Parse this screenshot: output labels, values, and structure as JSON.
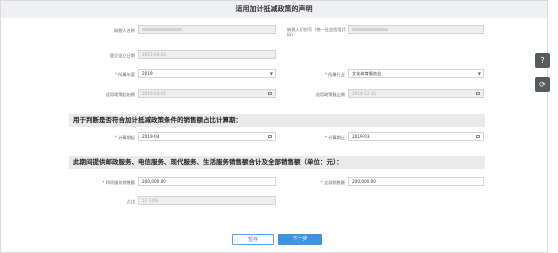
{
  "dialog": {
    "title": "适用加计抵减政策的声明"
  },
  "fields": {
    "taxpayer_name": {
      "label": "纳税人名称"
    },
    "taxpayer_id": {
      "label": "纳税人识别号（统一社会信用代码）"
    },
    "reg_date": {
      "label": "登记设立日期",
      "value": "2011-04-02"
    },
    "select_year": {
      "label": "* 所属年度",
      "value": "2019"
    },
    "industry": {
      "label": "* 所属行业",
      "value": "文化体育服务业"
    },
    "policy_start": {
      "label": "适用政策起始期",
      "value": "2019-04-01"
    },
    "policy_end": {
      "label": "适用政策截止期",
      "value": "2019-12-31"
    },
    "calc_start": {
      "label": "* 计算期起",
      "value": "2019-04"
    },
    "calc_end": {
      "label": "* 计算期止",
      "value": "2019-03"
    },
    "service_sales": {
      "label": "* 四项服务销售额",
      "value": "200,000.00"
    },
    "total_sales": {
      "label": "* 全部销售额",
      "value": "200,000.00"
    },
    "ratio": {
      "label": "占比",
      "value": "57.14%"
    }
  },
  "sections": {
    "calc_period": "用于判断是否符合加计抵减政策条件的销售额占比计算期：",
    "sales_amount": "此期间提供邮政服务、电信服务、现代服务、生活服务销售额合计及全部销售额（单位：元）："
  },
  "buttons": {
    "save": "暂存",
    "next": "下一步"
  },
  "sidebar": {
    "help_icon": "?",
    "refresh_icon": "⟳"
  }
}
